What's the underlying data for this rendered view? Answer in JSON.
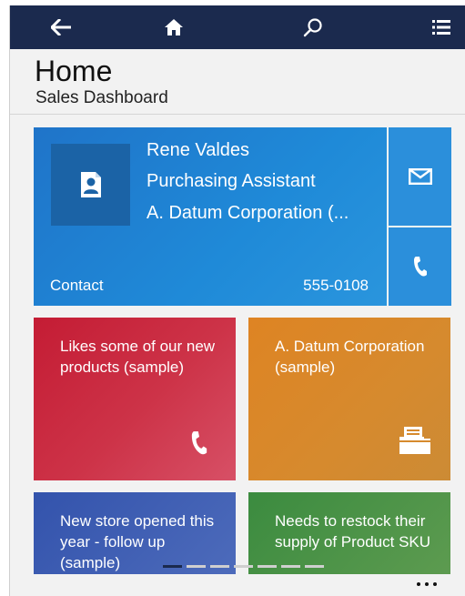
{
  "nav": {
    "back_icon": "arrow-left-icon",
    "home_icon": "home-icon",
    "search_icon": "search-icon",
    "menu_icon": "list-menu-icon"
  },
  "header": {
    "title": "Home",
    "subtitle": "Sales Dashboard"
  },
  "contact_card": {
    "name": "Rene Valdes",
    "role": "Purchasing Assistant",
    "company": "A. Datum Corporation (...",
    "type": "Contact",
    "phone": "555-0108",
    "avatar_icon": "contact-card-icon",
    "email_icon": "envelope-icon",
    "call_icon": "phone-icon"
  },
  "tiles": [
    {
      "text": "Likes some of our new products (sample)",
      "icon": "phone-icon",
      "color": "#c41c34"
    },
    {
      "text": "A. Datum Corporation (sample)",
      "icon": "folder-document-icon",
      "color": "#de8423"
    },
    {
      "text": "New store opened this year - follow up (sample)",
      "color": "#3353ac"
    },
    {
      "text": "Needs to restock their supply of Product SKU",
      "color": "#3b8b3f"
    }
  ],
  "pager": {
    "count": 7,
    "active_index": 0
  },
  "colors": {
    "navbar": "#1b2a4e",
    "contact_blue": "#1f86d6",
    "background": "#f2f2f2"
  }
}
